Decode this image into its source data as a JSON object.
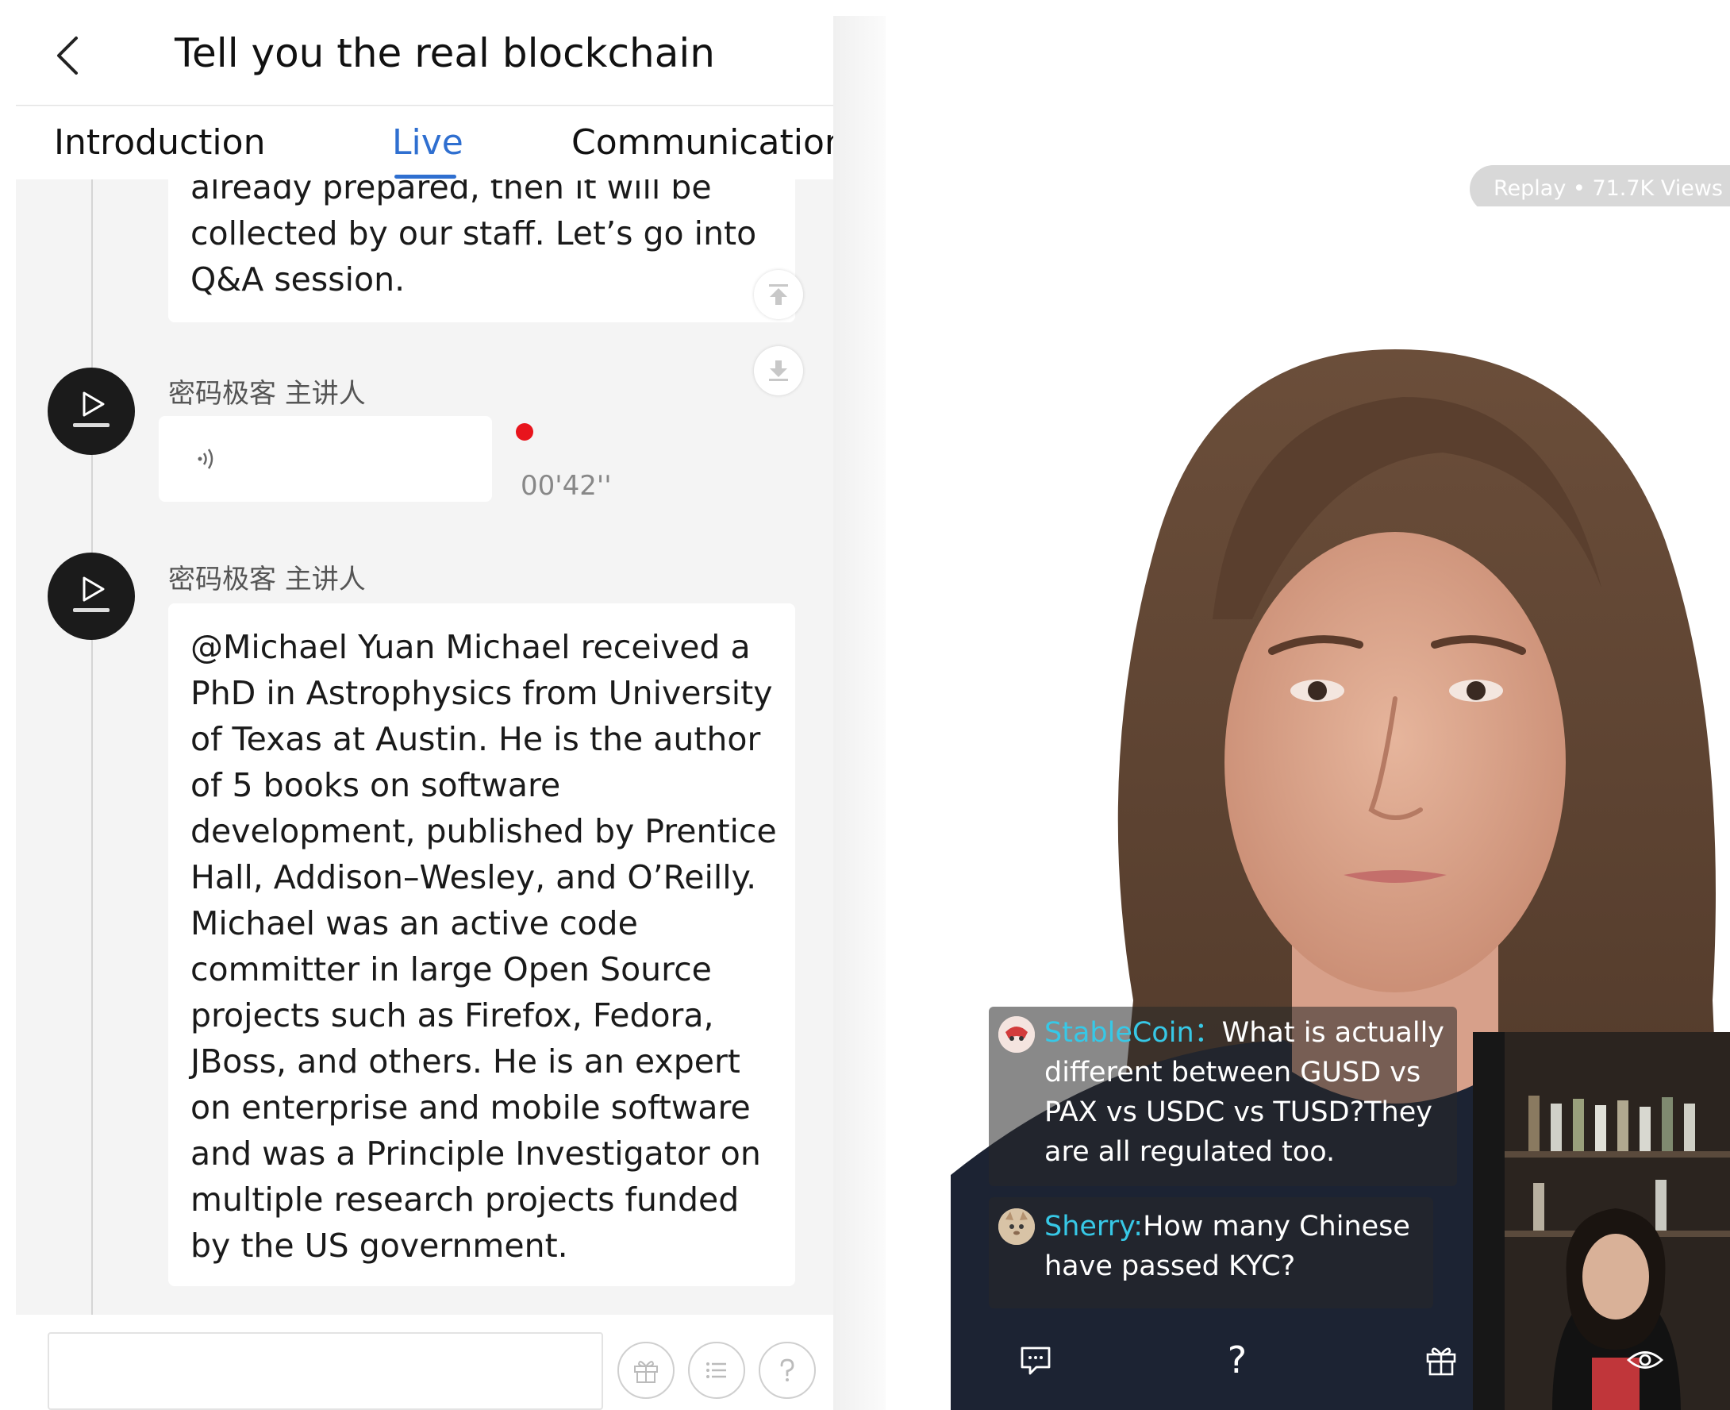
{
  "left": {
    "header": {
      "title": "Tell you the real blockchain"
    },
    "tabs": [
      {
        "label": "Introduction",
        "active": false
      },
      {
        "label": "Live",
        "active": true
      },
      {
        "label": "Communication",
        "active": false
      }
    ],
    "messages": [
      {
        "type": "text",
        "text": "already prepared,  then it will be collected by our staff.  Let’s go into Q&A session."
      },
      {
        "type": "audio",
        "sender": "密码极客",
        "role": "主讲人",
        "duration": "00'42''",
        "unread": true
      },
      {
        "type": "text",
        "sender": "密码极客",
        "role": "主讲人",
        "text": "@Michael Yuan Michael received a PhD in Astrophysics from University of Texas at Austin. He is the author of 5 books on software development, published by Prentice Hall, Addison–Wesley, and O’Reilly. Michael was an active code committer in large Open Source projects such as Firefox, Fedora, JBoss, and others. He is an expert on enterprise and mobile software and was a Principle Investigator on multiple research projects funded by the US government."
      }
    ],
    "footer": {
      "input_value": ""
    },
    "icons": [
      "back-chevron-icon",
      "scroll-top-icon",
      "scroll-bottom-icon",
      "play-logo-icon",
      "audio-wave-icon",
      "gift-icon",
      "list-icon",
      "question-icon"
    ]
  },
  "right": {
    "replay": {
      "label": "Replay",
      "views": "71.7K Views"
    },
    "comments": [
      {
        "user": "StableCoin：",
        "text": "What is actually different between GUSD vs PAX vs USDC vs TUSD?They are all regulated too."
      },
      {
        "user": "Sherry:",
        "text": "How many Chinese have passed KYC?"
      }
    ],
    "controls": {
      "help_glyph": "?"
    },
    "icons": [
      "chat-icon",
      "gift-icon",
      "eye-icon"
    ]
  },
  "colors": {
    "accent": "#2f6fd0",
    "unread": "#e8141c",
    "username": "#37c8e6",
    "avatar_bg": "#1b1b1b"
  }
}
